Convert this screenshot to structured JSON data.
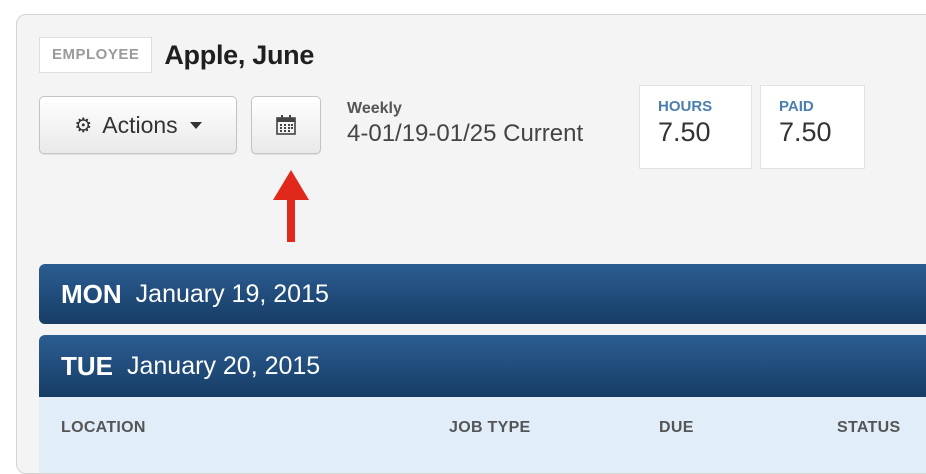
{
  "employee": {
    "badge_label": "EMPLOYEE",
    "name": "Apple, June"
  },
  "toolbar": {
    "actions_label": "Actions",
    "actions_icon": "gear-icon",
    "calendar_icon": "calendar-icon"
  },
  "period": {
    "label": "Weekly",
    "range": "4-01/19-01/25 Current"
  },
  "stats": {
    "hours_label": "HOURS",
    "hours_value": "7.50",
    "paid_label": "PAID",
    "paid_value": "7.50"
  },
  "days": [
    {
      "abbr": "MON",
      "date": "January 19, 2015"
    },
    {
      "abbr": "TUE",
      "date": "January 20, 2015"
    }
  ],
  "table": {
    "columns": [
      "LOCATION",
      "JOB TYPE",
      "DUE",
      "STATUS"
    ]
  },
  "colors": {
    "day_bar": "#1f4b7a",
    "stat_label": "#4a7fad",
    "table_header_bg": "#e1eefa",
    "annotation_arrow": "#e0281b"
  }
}
